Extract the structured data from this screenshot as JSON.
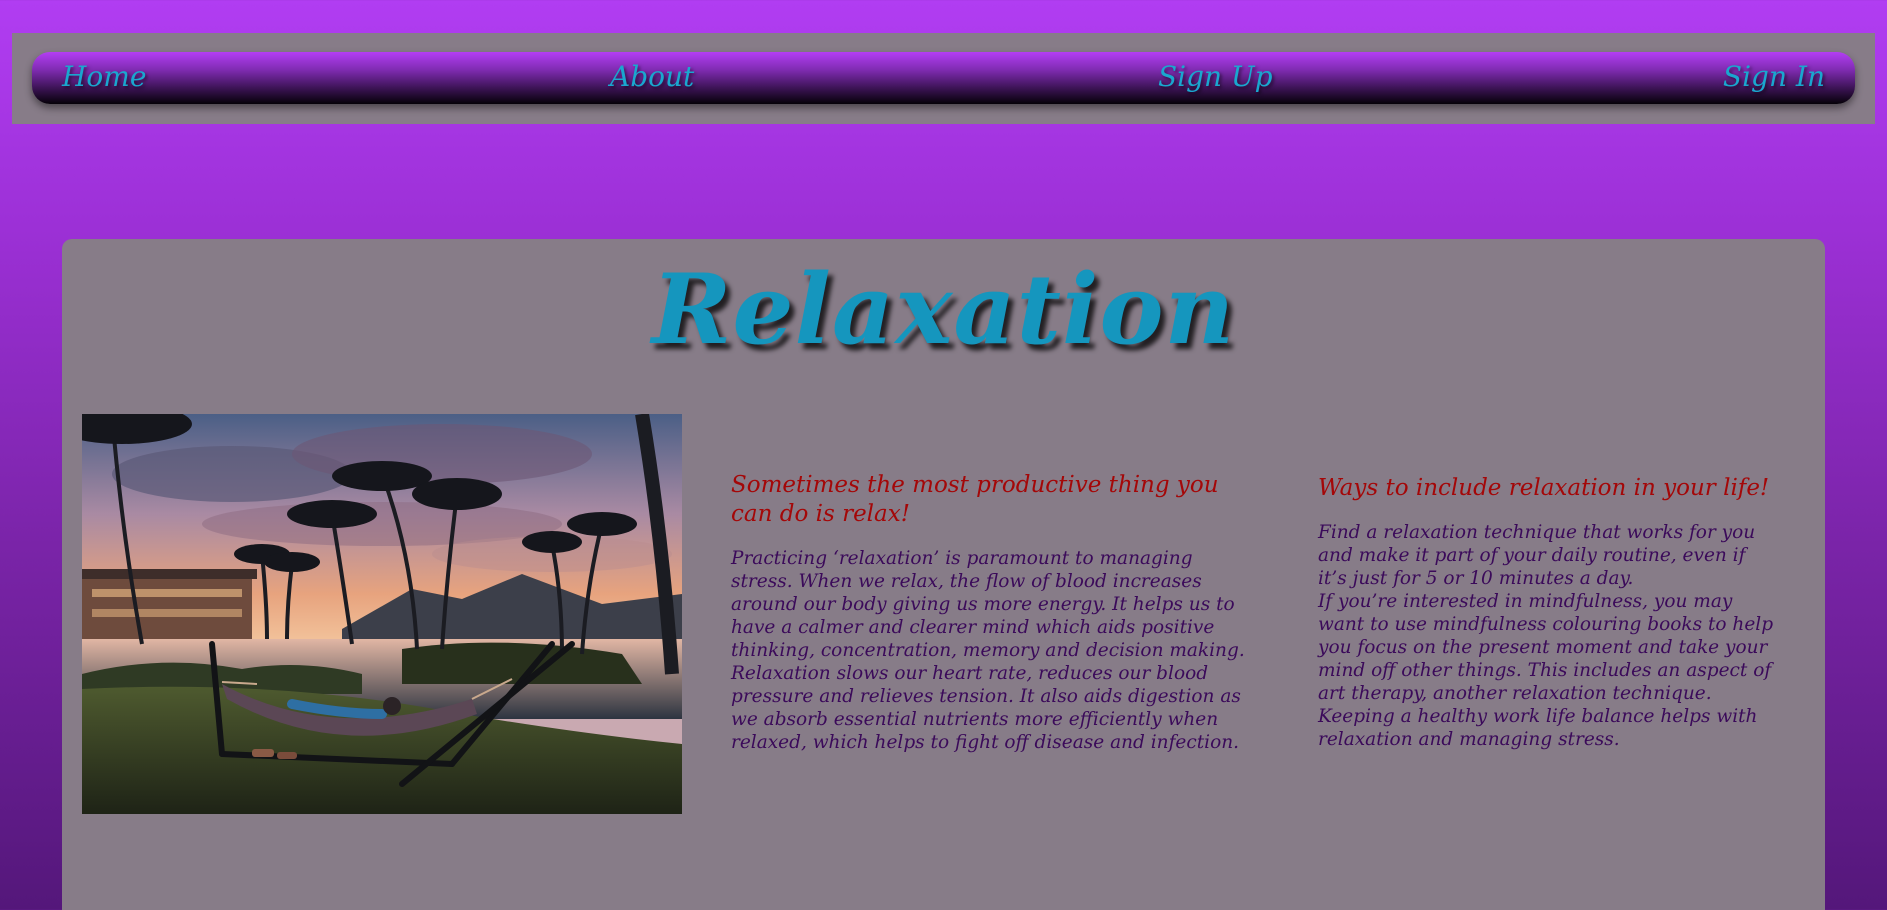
{
  "nav": {
    "home": "Home",
    "about": "About",
    "sign_up": "Sign Up",
    "sign_in": "Sign In"
  },
  "main": {
    "title": "Relaxation",
    "image": {
      "alt": "Hammock by a lagoon with palm trees at sunset",
      "icon": "photo-hammock-palm-trees"
    },
    "column1": {
      "heading": "Sometimes the most productive thing you can do is relax!",
      "paragraphs": [
        "Practicing ‘relaxation’ is paramount to managing stress. When we relax, the flow of blood increases around our body giving us more energy. It helps us to have a calmer and clearer mind which aids positive thinking, concentration, memory and decision making.",
        "Relaxation slows our heart rate, reduces our blood pressure and relieves tension. It also aids digestion as we absorb essential nutrients more efficiently when relaxed, which helps to fight off disease and infection."
      ]
    },
    "column2": {
      "heading": "Ways to include relaxation in your life!",
      "paragraphs": [
        "Find a relaxation technique that works for you and make it part of your daily routine, even if it’s just for 5 or 10 minutes a day.",
        "If you’re interested in mindfulness, you may want to use mindfulness colouring books to help you focus on the present moment and take your mind off other things. This includes an aspect of art therapy, another relaxation technique.",
        "Keeping a healthy work life balance helps with relaxation and managing stress."
      ]
    }
  },
  "colors": {
    "page_gradient_top": "#b13df2",
    "page_gradient_bottom": "#54177a",
    "panel": "#877c88",
    "nav_link": "#1aa7cf",
    "title": "#1596be",
    "heading": "#a40708",
    "body_text": "#3b0a5a"
  }
}
